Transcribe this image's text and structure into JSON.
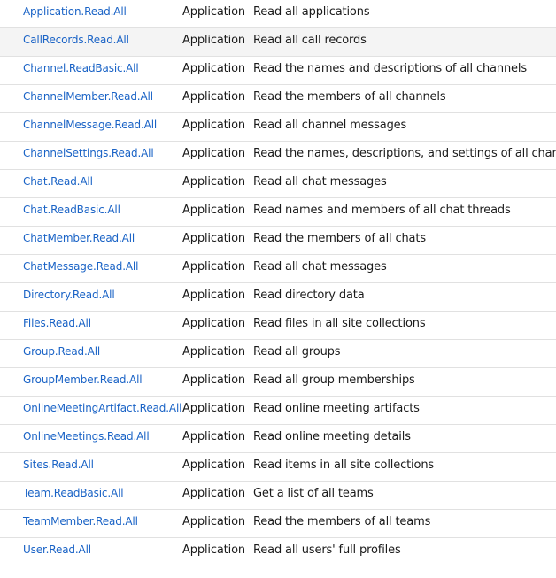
{
  "table": {
    "highlighted_row": 1,
    "rows": [
      {
        "permission": "Application.Read.All",
        "type": "Application",
        "description": "Read all applications"
      },
      {
        "permission": "CallRecords.Read.All",
        "type": "Application",
        "description": "Read all call records"
      },
      {
        "permission": "Channel.ReadBasic.All",
        "type": "Application",
        "description": "Read the names and descriptions of all channels"
      },
      {
        "permission": "ChannelMember.Read.All",
        "type": "Application",
        "description": "Read the members of all channels"
      },
      {
        "permission": "ChannelMessage.Read.All",
        "type": "Application",
        "description": "Read all channel messages"
      },
      {
        "permission": "ChannelSettings.Read.All",
        "type": "Application",
        "description": "Read the names, descriptions, and settings of all channels"
      },
      {
        "permission": "Chat.Read.All",
        "type": "Application",
        "description": "Read all chat messages"
      },
      {
        "permission": "Chat.ReadBasic.All",
        "type": "Application",
        "description": "Read names and members of all chat threads"
      },
      {
        "permission": "ChatMember.Read.All",
        "type": "Application",
        "description": "Read the members of all chats"
      },
      {
        "permission": "ChatMessage.Read.All",
        "type": "Application",
        "description": "Read all chat messages"
      },
      {
        "permission": "Directory.Read.All",
        "type": "Application",
        "description": "Read directory data"
      },
      {
        "permission": "Files.Read.All",
        "type": "Application",
        "description": "Read files in all site collections"
      },
      {
        "permission": "Group.Read.All",
        "type": "Application",
        "description": "Read all groups"
      },
      {
        "permission": "GroupMember.Read.All",
        "type": "Application",
        "description": "Read all group memberships"
      },
      {
        "permission": "OnlineMeetingArtifact.Read.All",
        "type": "Application",
        "description": "Read online meeting artifacts"
      },
      {
        "permission": "OnlineMeetings.Read.All",
        "type": "Application",
        "description": "Read online meeting details"
      },
      {
        "permission": "Sites.Read.All",
        "type": "Application",
        "description": "Read items in all site collections"
      },
      {
        "permission": "Team.ReadBasic.All",
        "type": "Application",
        "description": "Get a list of all teams"
      },
      {
        "permission": "TeamMember.Read.All",
        "type": "Application",
        "description": "Read the members of all teams"
      },
      {
        "permission": "User.Read.All",
        "type": "Application",
        "description": "Read all users' full profiles"
      }
    ]
  }
}
